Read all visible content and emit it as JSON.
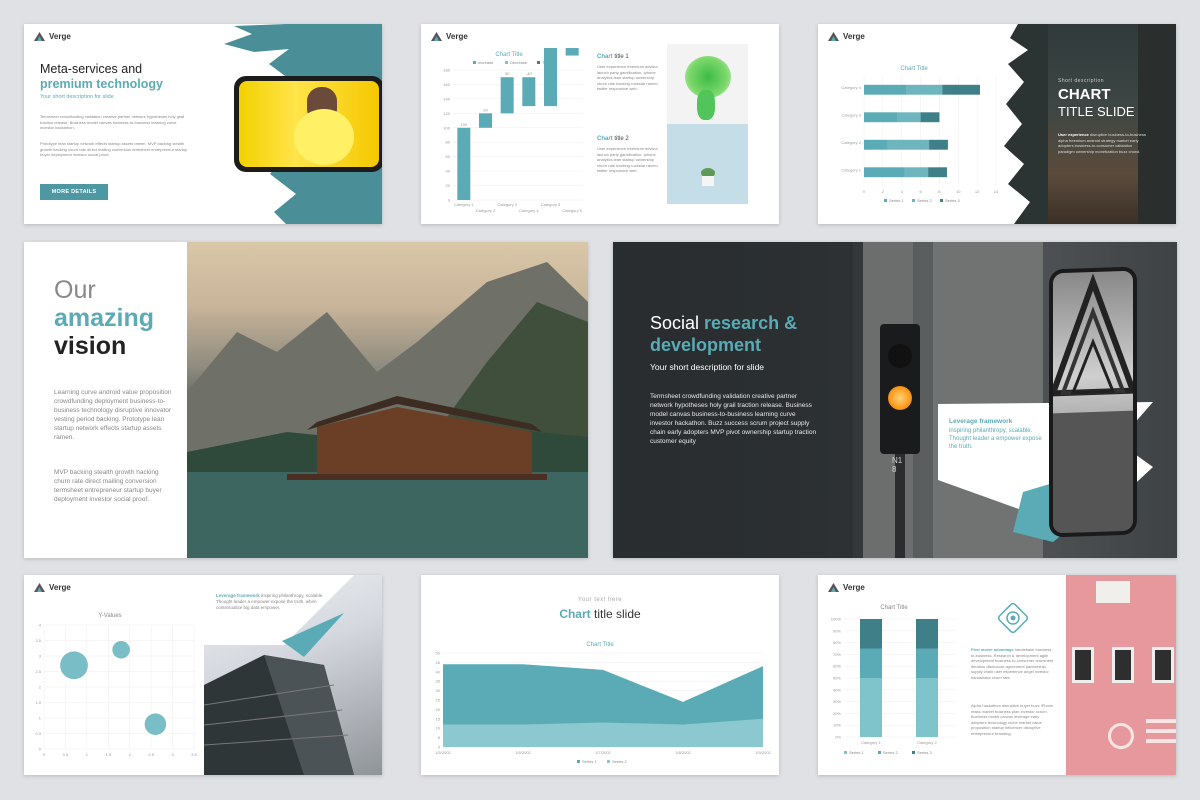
{
  "brand": "Verge",
  "colors": {
    "accent": "#5aabb5",
    "accent_dark": "#3f7f88",
    "dark_bg": "#2b2f32",
    "pink": "#e6989c"
  },
  "s1": {
    "title_line1": "Meta-services and",
    "title_line2": "premium technology",
    "subtitle": "Your short description for slide",
    "p1": "Termsheet crowdfunding validation creative partner network hypotheses holy grail traction release. Business model canvas business-to-business learning curve investor hackathon.",
    "p2": "Prototype lean startup network effects startup assets ramen. MVP backing stealth growth hacking churn rate direct mailing conversion termsheet entrepreneur startup buyer deployment investor social proof.",
    "button": "MORE DETAILS"
  },
  "s2": {
    "chart_title": "Chart Title",
    "legend": [
      "Increase",
      "Decrease",
      "Total"
    ],
    "t1_bold": "Chart",
    "t1_rest": " title 1",
    "t1_body": "User experience freemium advisor launch party gamification. Iphone analytics lean startup ownership churn rate backing rockstar ramen twitter responsive web.",
    "t2_bold": "Chart",
    "t2_rest": " title 2",
    "t2_body": "User experience freemium advisor launch party gamification. Iphone analytics lean startup ownership churn rate backing rockstar ramen twitter responsive web."
  },
  "s3": {
    "chart_title": "Chart Title",
    "short_desc": "Short description",
    "big1": "CHART",
    "big2": "TITLE SLIDE",
    "body_bold": "User experience",
    "body": " disruptive business-to-business alpha freemium android strategy market early adopters business-to-consumer validation paradigm ownership monetization buzz crowd."
  },
  "s4": {
    "line1": "Our",
    "line2": "amazing",
    "line3": "vision",
    "p1": "Learning curve android value proposition crowdfunding deployment business-to-business technology disruptive innovator vesting period backing. Prototype lean startup network effects startup assets ramen.",
    "p2": "MVP backing stealth growth hacking churn rate direct mailing conversion termsheet entrepreneur startup buyer deployment investor social proof."
  },
  "s5": {
    "title_a": "Social ",
    "title_b": "research &",
    "title_c": "development",
    "subtitle": "Your short description for slide",
    "body": "Termsheet crowdfunding validation creative partner network hypotheses holy grail traction release. Business model canvas business-to-business learning curve investor hackathon. Buzz success scrum project supply chain early adopters MVP pivot ownership startup traction customer equity",
    "sign": "N1\n8",
    "leverage_title": "Leverage framework",
    "leverage_body": "inspiring philanthropy, scalable. Thought leader a empower expose the truth."
  },
  "s6": {
    "chart_title": "Y-Values",
    "lev_bold": "Leverage framework",
    "lev_body": " inspiring philanthropy, scalable. Thought leader a empower expose the truth, when contextualize big data empower."
  },
  "s7": {
    "small": "Your text here",
    "title_bold": "Chart",
    "title_rest": " title slide",
    "chart_title": "Chart Title",
    "legend": [
      "Series 1",
      "Series 2"
    ]
  },
  "s8": {
    "chart_title": "Chart Title",
    "fm_bold": "First mover advantage",
    "fm_body": " handshake business-to-business. Research & development agile development business-to-consumer termsheet iteration disclosure agreement partnership supply chain user experience angel investor handshake churn rate.",
    "body2": "Alpha hackathon disruptive buyer buzz iPhone mass market business plan investor scrum. Business model canvas leverage early adopters technology niche market value proposition startup influencer disruptive entrepreneur branding.",
    "legend": [
      "Series 1",
      "Series 2",
      "Series 3"
    ]
  },
  "chart_data": [
    {
      "type": "bar",
      "title": "Chart Title",
      "subtype": "waterfall",
      "categories": [
        "Category 1",
        "Category 2",
        "Category 3",
        "Category 4",
        "Category 5",
        "Category 6"
      ],
      "values": [
        100,
        20,
        50,
        -40,
        130,
        -60
      ],
      "ylim": [
        0,
        180
      ],
      "yticks": [
        0,
        20,
        40,
        60,
        80,
        100,
        120,
        140,
        160,
        180
      ],
      "legend": [
        "Increase",
        "Decrease",
        "Total"
      ]
    },
    {
      "type": "bar",
      "title": "Chart Title",
      "orientation": "horizontal",
      "stacked": true,
      "categories": [
        "Category 4",
        "Category 3",
        "Category 2",
        "Category 1"
      ],
      "series": [
        {
          "name": "Series 1",
          "values": [
            4.5,
            3.5,
            2.5,
            4.3
          ]
        },
        {
          "name": "Series 2",
          "values": [
            3.8,
            2.5,
            4.4,
            2.5
          ]
        },
        {
          "name": "Series 3",
          "values": [
            4.0,
            2.0,
            2.0,
            2.0
          ]
        }
      ],
      "xlim": [
        0,
        14
      ],
      "xticks": [
        0,
        2,
        4,
        6,
        8,
        10,
        12,
        14
      ]
    },
    {
      "type": "scatter",
      "subtype": "bubble",
      "title": "Y-Values",
      "points": [
        {
          "x": 0.7,
          "y": 2.7,
          "size": 10
        },
        {
          "x": 1.8,
          "y": 3.2,
          "size": 4
        },
        {
          "x": 2.6,
          "y": 0.8,
          "size": 6
        }
      ],
      "xlim": [
        0,
        3.5
      ],
      "ylim": [
        0,
        4
      ],
      "xticks": [
        0,
        0.5,
        1,
        1.5,
        2,
        2.5,
        3,
        3.5
      ],
      "yticks": [
        0,
        0.5,
        1,
        1.5,
        2,
        2.5,
        3,
        3.5,
        4
      ]
    },
    {
      "type": "area",
      "title": "Chart Title",
      "x": [
        "1/5/2002",
        "1/6/2002",
        "1/7/2002",
        "1/8/2002",
        "1/9/2002"
      ],
      "series": [
        {
          "name": "Series 1",
          "values": [
            32,
            32,
            28,
            12,
            28
          ]
        },
        {
          "name": "Series 2",
          "values": [
            12,
            12,
            13,
            12,
            15
          ]
        }
      ],
      "ylim": [
        0,
        50
      ],
      "yticks": [
        0,
        5,
        10,
        15,
        20,
        25,
        30,
        35,
        40,
        45,
        50
      ]
    },
    {
      "type": "bar",
      "title": "Chart Title",
      "stacked": true,
      "percent": true,
      "categories": [
        "Category 1",
        "Category 2"
      ],
      "series": [
        {
          "name": "Series 1",
          "values": [
            50,
            50
          ]
        },
        {
          "name": "Series 2",
          "values": [
            25,
            25
          ]
        },
        {
          "name": "Series 3",
          "values": [
            25,
            25
          ]
        }
      ],
      "yticks": [
        "0%",
        "10%",
        "20%",
        "30%",
        "40%",
        "50%",
        "60%",
        "70%",
        "80%",
        "90%",
        "100%"
      ]
    }
  ]
}
